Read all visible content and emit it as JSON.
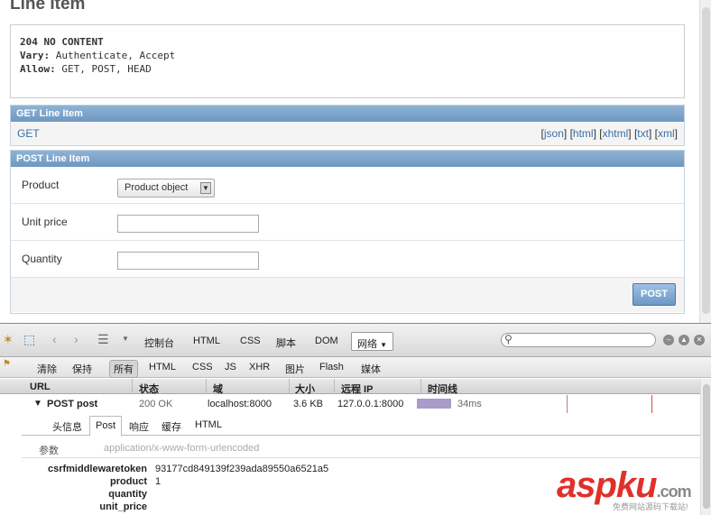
{
  "page": {
    "title": "Line Item",
    "response": {
      "status": "204 NO CONTENT",
      "vary_label": "Vary:",
      "vary_value": "Authenticate, Accept",
      "allow_label": "Allow:",
      "allow_value": "GET, POST, HEAD"
    },
    "get_panel": {
      "title": "GET Line Item",
      "get_link": "GET",
      "formats": [
        "json",
        "html",
        "xhtml",
        "txt",
        "xml"
      ]
    },
    "post_panel": {
      "title": "POST Line Item",
      "fields": {
        "product_label": "Product",
        "product_value": "Product object",
        "unit_price_label": "Unit price",
        "unit_price_value": "",
        "quantity_label": "Quantity",
        "quantity_value": ""
      },
      "submit_label": "POST"
    }
  },
  "firebug": {
    "main_tabs": [
      "控制台",
      "HTML",
      "CSS",
      "脚本",
      "DOM",
      "网络"
    ],
    "active_tab": "网络",
    "search_placeholder": "",
    "sub_toolbar": [
      "清除",
      "保持",
      "所有",
      "HTML",
      "CSS",
      "JS",
      "XHR",
      "图片",
      "Flash",
      "媒体"
    ],
    "sub_active": "所有",
    "columns": [
      "URL",
      "状态",
      "域",
      "大小",
      "远程 IP",
      "时间线"
    ],
    "request": {
      "method_url": "POST post",
      "status": "200 OK",
      "domain": "localhost:8000",
      "size": "3.6 KB",
      "remote_ip": "127.0.0.1:8000",
      "time": "34ms"
    },
    "detail_tabs": [
      "头信息",
      "Post",
      "响应",
      "缓存",
      "HTML"
    ],
    "detail_active": "Post",
    "params_label": "参数",
    "content_type": "application/x-www-form-urlencoded",
    "params": [
      {
        "name": "csrfmiddlewaretoken",
        "value": "93177cd849139f239ada89550a6521a5"
      },
      {
        "name": "product",
        "value": "1"
      },
      {
        "name": "quantity",
        "value": ""
      },
      {
        "name": "unit_price",
        "value": ""
      }
    ]
  },
  "watermark": {
    "brand": "aspku",
    "suffix": ".com",
    "tagline": "免费网站源码下载站!"
  },
  "colors": {
    "panel_header": "#7ea6cc",
    "link": "#3a6ea5",
    "post_button": "#6c98c8",
    "timeline_bar": "#a99cc9",
    "watermark": "#e0302a"
  }
}
